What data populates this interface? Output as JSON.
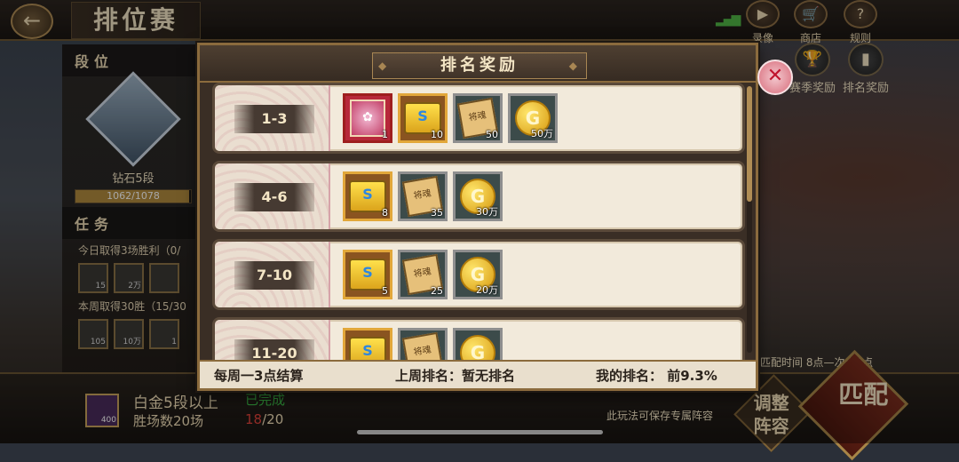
{
  "header": {
    "back_icon": "←",
    "title": "排位赛",
    "top_icons": [
      {
        "name": "record",
        "label": "录像",
        "glyph": "▶"
      },
      {
        "name": "shop",
        "label": "商店",
        "glyph": "🛒"
      },
      {
        "name": "rules",
        "label": "规则",
        "glyph": "?"
      }
    ]
  },
  "side_buttons": [
    {
      "label": "赛季奖励",
      "glyph": "🏆"
    },
    {
      "label": "排名奖励",
      "glyph": "▮"
    }
  ],
  "left_panel": {
    "section_rank": "段位",
    "rank_name": "钻石5段",
    "xp_text": "1062/1078",
    "xp_progress": 0.985,
    "section_tasks": "任务",
    "task1": "今日取得3场胜利（0/",
    "task1_items": [
      "15",
      "2万",
      ""
    ],
    "task2": "本周取得30胜（15/30",
    "task2_items": [
      "105",
      "10万",
      "1"
    ]
  },
  "bottom": {
    "item_qty": "400",
    "line1": "白金5段以上",
    "status": "已完成",
    "line2": "胜场数20场",
    "progress_current": "18",
    "progress_total": "/20",
    "match_time": "匹配时间 8点—次日1点",
    "save_hint": "此玩法可保存专属阵容",
    "adjust_label": "调整阵容",
    "match_label": "匹配"
  },
  "modal": {
    "title": "排名奖励",
    "close_glyph": "✕",
    "rows": [
      {
        "rank": "1-3",
        "items": [
          {
            "kind": "scroll",
            "qty": "1"
          },
          {
            "kind": "chest",
            "qty": "10"
          },
          {
            "kind": "puzzle",
            "qty": "50"
          },
          {
            "kind": "coin",
            "qty": "50万"
          }
        ]
      },
      {
        "rank": "4-6",
        "items": [
          {
            "kind": "chest",
            "qty": "8"
          },
          {
            "kind": "puzzle",
            "qty": "35"
          },
          {
            "kind": "coin",
            "qty": "30万"
          }
        ]
      },
      {
        "rank": "7-10",
        "items": [
          {
            "kind": "chest",
            "qty": "5"
          },
          {
            "kind": "puzzle",
            "qty": "25"
          },
          {
            "kind": "coin",
            "qty": "20万"
          }
        ]
      },
      {
        "rank": "11-20",
        "items": [
          {
            "kind": "chest",
            "qty": ""
          },
          {
            "kind": "puzzle",
            "qty": ""
          },
          {
            "kind": "coin",
            "qty": ""
          }
        ]
      }
    ],
    "footer": {
      "settle": "每周一3点结算",
      "last_week": "上周排名：暂无排名",
      "mine": "我的排名： 前9.3%"
    }
  }
}
